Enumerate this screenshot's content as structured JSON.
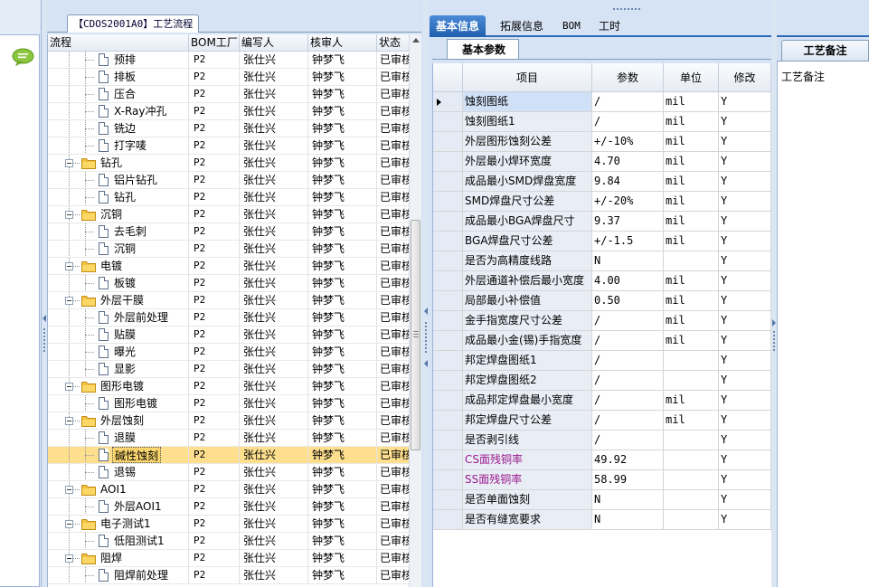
{
  "left_panel": {
    "group_title": "【CDOS2001A0】工艺流程",
    "columns": [
      "流程",
      "BOM工厂",
      "编写人",
      "核审人",
      "状态"
    ],
    "rows": [
      {
        "name": "预排",
        "level": 2,
        "type": "doc",
        "bom": "P2",
        "author": "张仕兴",
        "reviewer": "钟梦飞",
        "status": "已审核"
      },
      {
        "name": "排板",
        "level": 2,
        "type": "doc",
        "bom": "P2",
        "author": "张仕兴",
        "reviewer": "钟梦飞",
        "status": "已审核"
      },
      {
        "name": "压合",
        "level": 2,
        "type": "doc",
        "bom": "P2",
        "author": "张仕兴",
        "reviewer": "钟梦飞",
        "status": "已审核"
      },
      {
        "name": "X-Ray冲孔",
        "level": 2,
        "type": "doc",
        "bom": "P2",
        "author": "张仕兴",
        "reviewer": "钟梦飞",
        "status": "已审核"
      },
      {
        "name": "铣边",
        "level": 2,
        "type": "doc",
        "bom": "P2",
        "author": "张仕兴",
        "reviewer": "钟梦飞",
        "status": "已审核"
      },
      {
        "name": "打字唛",
        "level": 2,
        "type": "doc",
        "bom": "P2",
        "author": "张仕兴",
        "reviewer": "钟梦飞",
        "status": "已审核"
      },
      {
        "name": "钻孔",
        "level": 1,
        "type": "folder",
        "bom": "P2",
        "author": "张仕兴",
        "reviewer": "钟梦飞",
        "status": "已审核"
      },
      {
        "name": "铝片钻孔",
        "level": 2,
        "type": "doc",
        "bom": "P2",
        "author": "张仕兴",
        "reviewer": "钟梦飞",
        "status": "已审核"
      },
      {
        "name": "钻孔",
        "level": 2,
        "type": "doc",
        "bom": "P2",
        "author": "张仕兴",
        "reviewer": "钟梦飞",
        "status": "已审核"
      },
      {
        "name": "沉铜",
        "level": 1,
        "type": "folder",
        "bom": "P2",
        "author": "张仕兴",
        "reviewer": "钟梦飞",
        "status": "已审核"
      },
      {
        "name": "去毛刺",
        "level": 2,
        "type": "doc",
        "bom": "P2",
        "author": "张仕兴",
        "reviewer": "钟梦飞",
        "status": "已审核"
      },
      {
        "name": "沉铜",
        "level": 2,
        "type": "doc",
        "bom": "P2",
        "author": "张仕兴",
        "reviewer": "钟梦飞",
        "status": "已审核"
      },
      {
        "name": "电镀",
        "level": 1,
        "type": "folder",
        "bom": "P2",
        "author": "张仕兴",
        "reviewer": "钟梦飞",
        "status": "已审核"
      },
      {
        "name": "板镀",
        "level": 2,
        "type": "doc",
        "bom": "P2",
        "author": "张仕兴",
        "reviewer": "钟梦飞",
        "status": "已审核"
      },
      {
        "name": "外层干膜",
        "level": 1,
        "type": "folder",
        "bom": "P2",
        "author": "张仕兴",
        "reviewer": "钟梦飞",
        "status": "已审核"
      },
      {
        "name": "外层前处理",
        "level": 2,
        "type": "doc",
        "bom": "P2",
        "author": "张仕兴",
        "reviewer": "钟梦飞",
        "status": "已审核"
      },
      {
        "name": "贴膜",
        "level": 2,
        "type": "doc",
        "bom": "P2",
        "author": "张仕兴",
        "reviewer": "钟梦飞",
        "status": "已审核"
      },
      {
        "name": "曝光",
        "level": 2,
        "type": "doc",
        "bom": "P2",
        "author": "张仕兴",
        "reviewer": "钟梦飞",
        "status": "已审核"
      },
      {
        "name": "显影",
        "level": 2,
        "type": "doc",
        "bom": "P2",
        "author": "张仕兴",
        "reviewer": "钟梦飞",
        "status": "已审核"
      },
      {
        "name": "图形电镀",
        "level": 1,
        "type": "folder",
        "bom": "P2",
        "author": "张仕兴",
        "reviewer": "钟梦飞",
        "status": "已审核"
      },
      {
        "name": "图形电镀",
        "level": 2,
        "type": "doc",
        "bom": "P2",
        "author": "张仕兴",
        "reviewer": "钟梦飞",
        "status": "已审核"
      },
      {
        "name": "外层蚀刻",
        "level": 1,
        "type": "folder",
        "bom": "P2",
        "author": "张仕兴",
        "reviewer": "钟梦飞",
        "status": "已审核"
      },
      {
        "name": "退膜",
        "level": 2,
        "type": "doc",
        "bom": "P2",
        "author": "张仕兴",
        "reviewer": "钟梦飞",
        "status": "已审核"
      },
      {
        "name": "碱性蚀刻",
        "level": 2,
        "type": "doc",
        "bom": "P2",
        "author": "张仕兴",
        "reviewer": "钟梦飞",
        "status": "已审核",
        "selected": true
      },
      {
        "name": "退锡",
        "level": 2,
        "type": "doc",
        "bom": "P2",
        "author": "张仕兴",
        "reviewer": "钟梦飞",
        "status": "已审核"
      },
      {
        "name": "AOI1",
        "level": 1,
        "type": "folder",
        "bom": "P2",
        "author": "张仕兴",
        "reviewer": "钟梦飞",
        "status": "已审核"
      },
      {
        "name": "外层AOI1",
        "level": 2,
        "type": "doc",
        "bom": "P2",
        "author": "张仕兴",
        "reviewer": "钟梦飞",
        "status": "已审核"
      },
      {
        "name": "电子测试1",
        "level": 1,
        "type": "folder",
        "bom": "P2",
        "author": "张仕兴",
        "reviewer": "钟梦飞",
        "status": "已审核"
      },
      {
        "name": "低阻测试1",
        "level": 2,
        "type": "doc",
        "bom": "P2",
        "author": "张仕兴",
        "reviewer": "钟梦飞",
        "status": "已审核"
      },
      {
        "name": "阻焊",
        "level": 1,
        "type": "folder",
        "bom": "P2",
        "author": "张仕兴",
        "reviewer": "钟梦飞",
        "status": "已审核"
      },
      {
        "name": "阻焊前处理",
        "level": 2,
        "type": "doc",
        "bom": "P2",
        "author": "张仕兴",
        "reviewer": "钟梦飞",
        "status": "已审核"
      }
    ]
  },
  "right_panel": {
    "tabs": [
      "基本信息",
      "拓展信息",
      "BOM",
      "工时"
    ],
    "active_tab": "基本信息",
    "subtab": "基本参数",
    "columns": [
      "项目",
      "参数",
      "单位",
      "修改"
    ],
    "rows": [
      {
        "item": "蚀刻图纸",
        "value": "/",
        "unit": "mil",
        "modify": "Y"
      },
      {
        "item": "蚀刻图纸1",
        "value": "/",
        "unit": "mil",
        "modify": "Y"
      },
      {
        "item": "外层图形蚀刻公差",
        "value": "+/-10%",
        "unit": "mil",
        "modify": "Y"
      },
      {
        "item": "外层最小焊环宽度",
        "value": "4.70",
        "unit": "mil",
        "modify": "Y"
      },
      {
        "item": "成品最小SMD焊盘宽度",
        "value": "9.84",
        "unit": "mil",
        "modify": "Y"
      },
      {
        "item": "SMD焊盘尺寸公差",
        "value": "+/-20%",
        "unit": "mil",
        "modify": "Y"
      },
      {
        "item": "成品最小BGA焊盘尺寸",
        "value": "9.37",
        "unit": "mil",
        "modify": "Y"
      },
      {
        "item": "BGA焊盘尺寸公差",
        "value": "+/-1.5",
        "unit": "mil",
        "modify": "Y"
      },
      {
        "item": "是否为高精度线路",
        "value": "N",
        "unit": "",
        "modify": "Y"
      },
      {
        "item": "外层通道补偿后最小宽度",
        "value": "4.00",
        "unit": "mil",
        "modify": "Y"
      },
      {
        "item": "局部最小补偿值",
        "value": "0.50",
        "unit": "mil",
        "modify": "Y"
      },
      {
        "item": "金手指宽度尺寸公差",
        "value": "/",
        "unit": "mil",
        "modify": "Y"
      },
      {
        "item": "成品最小金(锡)手指宽度",
        "value": "/",
        "unit": "mil",
        "modify": "Y"
      },
      {
        "item": "邦定焊盘图纸1",
        "value": "/",
        "unit": "",
        "modify": "Y"
      },
      {
        "item": "邦定焊盘图纸2",
        "value": "/",
        "unit": "",
        "modify": "Y"
      },
      {
        "item": "成品邦定焊盘最小宽度",
        "value": "/",
        "unit": "mil",
        "modify": "Y"
      },
      {
        "item": "邦定焊盘尺寸公差",
        "value": "/",
        "unit": "mil",
        "modify": "Y"
      },
      {
        "item": "是否剥引线",
        "value": "/",
        "unit": "",
        "modify": "Y"
      },
      {
        "item": "CS面残铜率",
        "value": "49.92",
        "unit": "",
        "modify": "Y",
        "highlight": true
      },
      {
        "item": "SS面残铜率",
        "value": "58.99",
        "unit": "",
        "modify": "Y",
        "highlight": true
      },
      {
        "item": "是否单面蚀刻",
        "value": "N",
        "unit": "",
        "modify": "Y"
      },
      {
        "item": "是否有缝宽要求",
        "value": "N",
        "unit": "",
        "modify": "Y"
      }
    ]
  },
  "remarks_panel": {
    "tab_label": "工艺备注",
    "field_label": "工艺备注"
  },
  "colors": {
    "accent_blue": "#2d6bb8",
    "selection_yellow": "#fddf8e",
    "highlight_purple": "#9b1b8e",
    "folder_yellow": "#f5c342"
  },
  "icons": [
    "chat-bubble-icon",
    "folder-icon",
    "document-icon",
    "tree-collapse-icon",
    "row-pointer-icon",
    "sort-arrow-icon"
  ]
}
